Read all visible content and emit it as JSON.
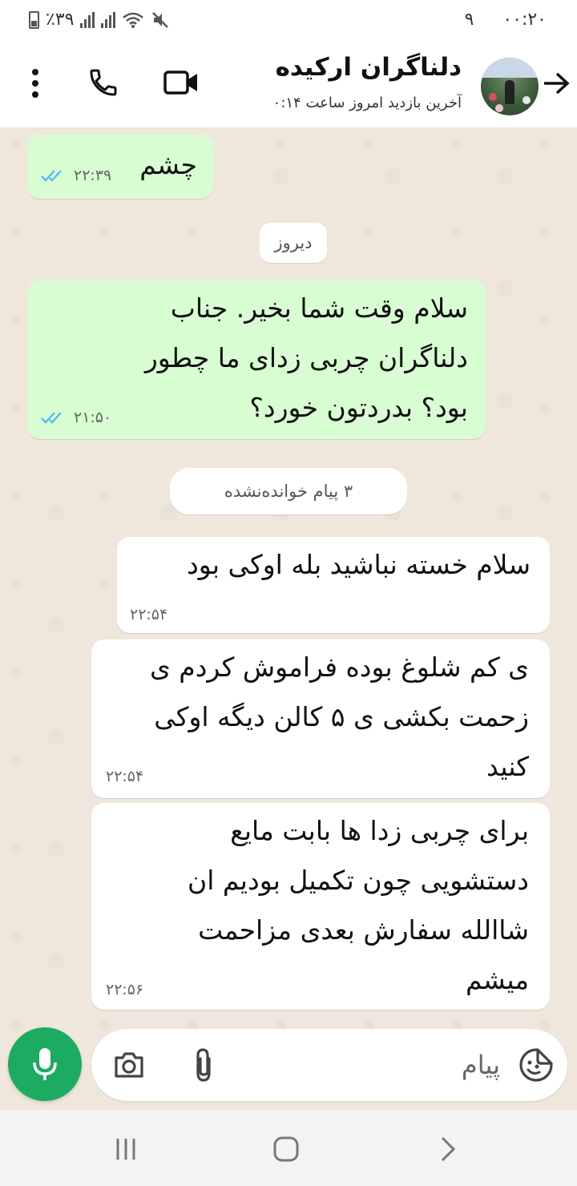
{
  "status_bar": {
    "time": "۰۰:۲۰",
    "notif_count": "۹",
    "battery": "٪۳۹"
  },
  "header": {
    "contact_name": "دلناگران ارکیده",
    "last_seen": "آخرین بازدید امروز ساعت ۰:۱۴",
    "icons": [
      "more-vert-icon",
      "phone-icon",
      "video-camera-icon",
      "back-arrow-icon"
    ]
  },
  "chat": {
    "messages": [
      {
        "direction": "outgoing",
        "text": "چشم",
        "time": "۲۲:۳۹",
        "status": "read"
      },
      {
        "direction": "outgoing",
        "text": "سلام وقت شما بخیر. جناب دلناگران چربی زدای ما چطور بود؟ بدردتون خورد؟",
        "time": "۲۱:۵۰",
        "status": "read"
      },
      {
        "direction": "incoming",
        "text": "سلام خسته نباشید بله اوکی بود",
        "time": "۲۲:۵۴"
      },
      {
        "direction": "incoming",
        "text": "ی کم شلوغ بوده فراموش کردم ی زحمت بکشی ی ۵ کالن دیگه اوکی کنید",
        "time": "۲۲:۵۴"
      },
      {
        "direction": "incoming",
        "text": "برای چربی زدا ها بابت مایع دستشویی چون تکمیل بودیم ان شاالله سفارش بعدی مزاحمت میشم",
        "time": "۲۲:۵۶"
      }
    ],
    "date_divider": "دیروز",
    "unread_divider": "۳ پیام خوانده‌نشده"
  },
  "input": {
    "placeholder": "پیام"
  },
  "colors": {
    "outgoing_bubble": "#d9fdd3",
    "incoming_bubble": "#ffffff",
    "chat_background": "#efe7dc",
    "accent_green": "#1daa61",
    "read_ticks": "#53bdeb"
  }
}
